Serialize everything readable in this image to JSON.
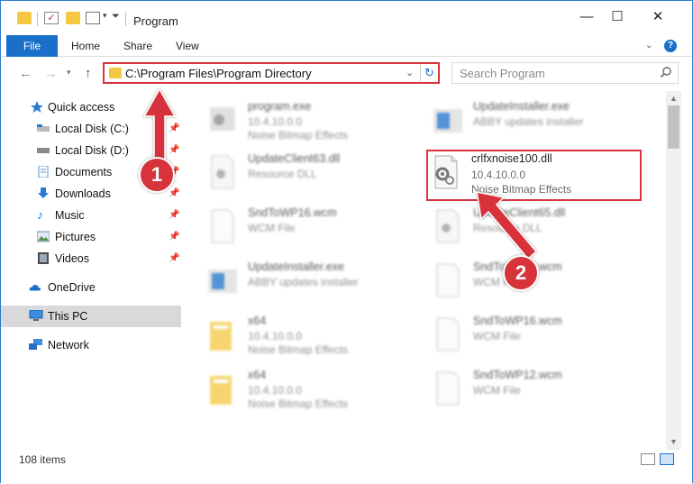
{
  "window": {
    "title": "Program",
    "controls": {
      "minimize": "—",
      "maximize": "☐",
      "close": "✕"
    }
  },
  "ribbon": {
    "tabs": [
      "File",
      "Home",
      "Share",
      "View"
    ],
    "help": "?"
  },
  "address": {
    "path": "C:\\Program Files\\Program Directory",
    "search_placeholder": "Search Program"
  },
  "sidebar": {
    "items": [
      {
        "label": "Quick access",
        "icon": "star-icon",
        "pinned": false
      },
      {
        "label": "Local Disk (C:)",
        "icon": "drive-icon",
        "pinned": true
      },
      {
        "label": "Local Disk (D:)",
        "icon": "drive-icon",
        "pinned": true
      },
      {
        "label": "Documents",
        "icon": "documents-icon",
        "pinned": true
      },
      {
        "label": "Downloads",
        "icon": "downloads-icon",
        "pinned": true
      },
      {
        "label": "Music",
        "icon": "music-icon",
        "pinned": true
      },
      {
        "label": "Pictures",
        "icon": "pictures-icon",
        "pinned": true
      },
      {
        "label": "Videos",
        "icon": "videos-icon",
        "pinned": true
      },
      {
        "label": "OneDrive",
        "icon": "onedrive-icon",
        "pinned": false
      },
      {
        "label": "This PC",
        "icon": "pc-icon",
        "pinned": false
      },
      {
        "label": "Network",
        "icon": "network-icon",
        "pinned": false
      }
    ]
  },
  "files": {
    "left": [
      {
        "name": "program.exe",
        "line1": "10.4.10.0.0",
        "line2": "Noise Bitmap Effects",
        "type": "exe"
      },
      {
        "name": "UpdateClient63.dll",
        "line1": "Resource DLL",
        "line2": "",
        "type": "dll"
      },
      {
        "name": "SndToWP16.wcm",
        "line1": "WCM File",
        "line2": "",
        "type": "file"
      },
      {
        "name": "UpdateInstaller.exe",
        "line1": "ABBY updates installer",
        "line2": "",
        "type": "exe"
      },
      {
        "name": "x64",
        "line1": "10.4.10.0.0",
        "line2": "Noise Bitmap Effects",
        "type": "folder"
      },
      {
        "name": "x64",
        "line1": "10.4.10.0.0",
        "line2": "Noise Bitmap Effects",
        "type": "folder"
      }
    ],
    "right": [
      {
        "name": "UpdateInstaller.exe",
        "line1": "ABBY updates installer",
        "line2": "",
        "type": "exe"
      },
      {
        "name": "crlfxnoise100.dll",
        "line1": "10.4.10.0.0",
        "line2": "Noise Bitmap Effects",
        "type": "dll"
      },
      {
        "name": "UpdateClient65.dll",
        "line1": "Resource DLL",
        "line2": "",
        "type": "dll"
      },
      {
        "name": "SndToWP16.wcm",
        "line1": "WCM File",
        "line2": "",
        "type": "file"
      },
      {
        "name": "SndToWP16.wcm",
        "line1": "WCM File",
        "line2": "",
        "type": "file"
      },
      {
        "name": "SndToWP12.wcm",
        "line1": "WCM File",
        "line2": "",
        "type": "file"
      }
    ]
  },
  "status": {
    "count": "108 items"
  },
  "annotations": {
    "step1": "1",
    "step2": "2"
  },
  "colors": {
    "accent": "#1a6fc9",
    "highlight": "#d7333a",
    "folder": "#f4c842"
  }
}
